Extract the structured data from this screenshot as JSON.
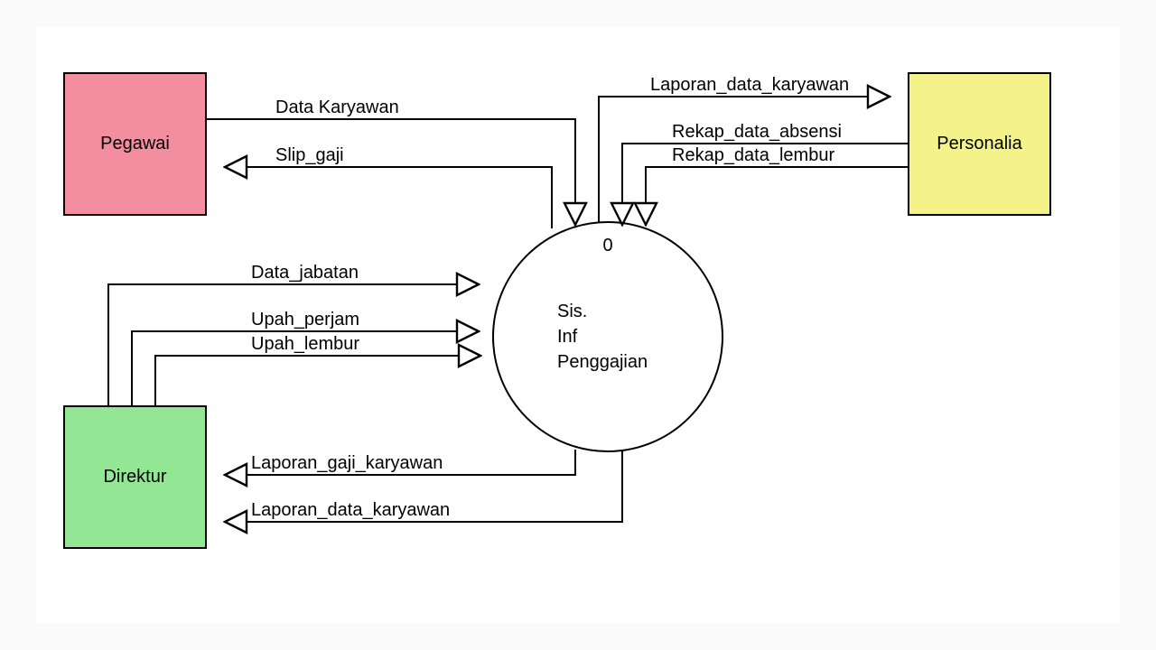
{
  "entities": {
    "pegawai": {
      "label": "Pegawai",
      "color": "pink"
    },
    "personalia": {
      "label": "Personalia",
      "color": "yellow"
    },
    "direktur": {
      "label": "Direktur",
      "color": "green"
    }
  },
  "process": {
    "id": "0",
    "name_line1": "Sis.",
    "name_line2": "Inf",
    "name_line3": "Penggajian"
  },
  "flows": {
    "data_karyawan": "Data Karyawan",
    "slip_gaji": "Slip_gaji",
    "laporan_data_karyawan_top": "Laporan_data_karyawan",
    "rekap_data_absensi": "Rekap_data_absensi",
    "rekap_data_lembur": "Rekap_data_lembur",
    "data_jabatan": "Data_jabatan",
    "upah_perjam": "Upah_perjam",
    "upah_lembur": "Upah_lembur",
    "laporan_gaji_karyawan": "Laporan_gaji_karyawan",
    "laporan_data_karyawan_bot": "Laporan_data_karyawan"
  }
}
